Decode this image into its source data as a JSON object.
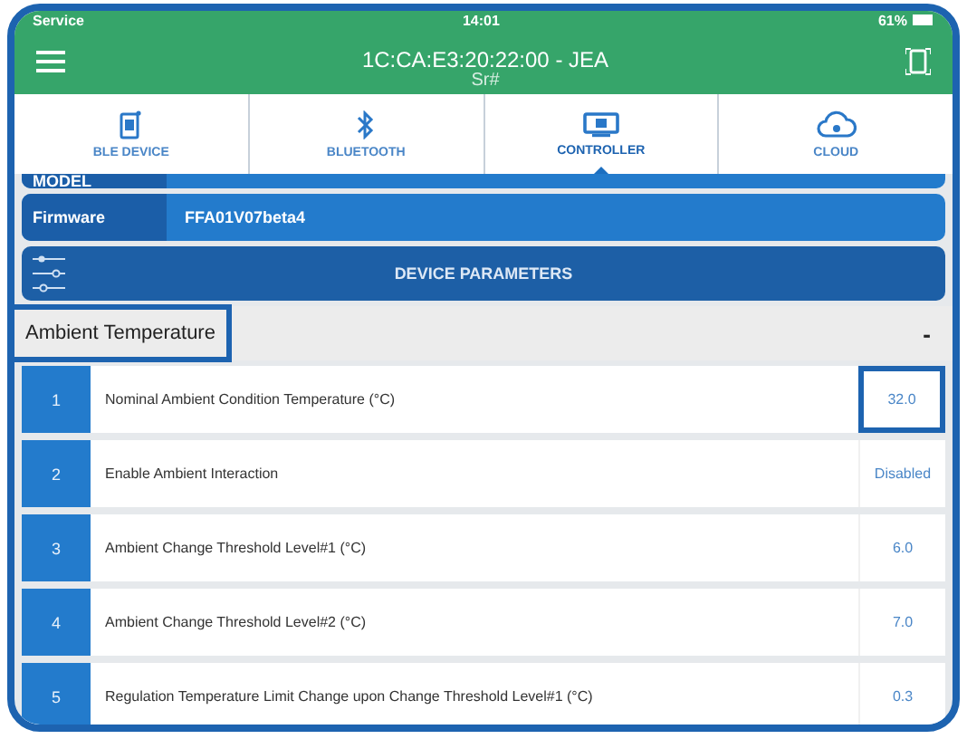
{
  "status_bar": {
    "carrier": "Service",
    "time": "14:01",
    "battery": "61%"
  },
  "header": {
    "title": "1C:CA:E3:20:22:00 - JEA",
    "subtitle": "Sr#"
  },
  "tabs": [
    {
      "label": "BLE DEVICE",
      "kind": "phone",
      "selected": false
    },
    {
      "label": "BLUETOOTH",
      "kind": "bluetooth",
      "selected": false
    },
    {
      "label": "CONTROLLER",
      "kind": "screen",
      "selected": true
    },
    {
      "label": "CLOUD",
      "kind": "cloud",
      "selected": false
    }
  ],
  "info_rows": [
    {
      "label": "MODEL"
    },
    {
      "label": "Firmware",
      "value": "FFA01V07beta4"
    }
  ],
  "section_bar": {
    "title": "DEVICE PARAMETERS"
  },
  "group": {
    "title": "Ambient Temperature",
    "toggle": "-",
    "highlighted": true
  },
  "parameters": [
    {
      "index": "1",
      "name": "Nominal Ambient Condition Temperature (°C)",
      "value": "32.0",
      "highlighted": true
    },
    {
      "index": "2",
      "name": "Enable Ambient Interaction",
      "value": "Disabled",
      "highlighted": false
    },
    {
      "index": "3",
      "name": "Ambient Change Threshold Level#1 (°C)",
      "value": "6.0",
      "highlighted": false
    },
    {
      "index": "4",
      "name": "Ambient Change Threshold Level#2 (°C)",
      "value": "7.0",
      "highlighted": false
    },
    {
      "index": "5",
      "name": "Regulation Temperature Limit Change upon Change Threshold Level#1 (°C)",
      "value": "0.3",
      "highlighted": false
    }
  ]
}
